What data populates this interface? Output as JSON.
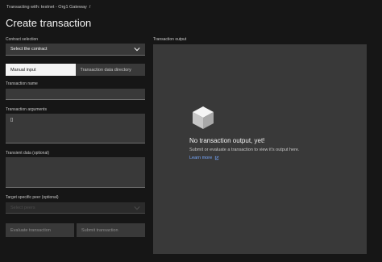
{
  "breadcrumb": {
    "text": "Transacting with: testnet - Org1 Gateway",
    "separator": "/"
  },
  "page_title": "Create transaction",
  "form": {
    "contract_selection": {
      "label": "Contract selection",
      "value": "Select the contract",
      "icon": "chevron-down-icon"
    },
    "tabs": [
      {
        "label": "Manual input",
        "selected": true
      },
      {
        "label": "Transaction data directory",
        "selected": false
      }
    ],
    "transaction_name": {
      "label": "Transaction name",
      "value": ""
    },
    "transaction_arguments": {
      "label": "Transaction arguments",
      "value": "[]"
    },
    "transient_data": {
      "label": "Transient data (optional)",
      "value": ""
    },
    "target_peer": {
      "label": "Target specific peer (optional)",
      "placeholder": "Select peers",
      "icon": "chevron-down-icon"
    },
    "buttons": {
      "evaluate": "Evaluate transaction",
      "submit": "Submit transaction"
    }
  },
  "output": {
    "label": "Transaction output",
    "empty_icon": "cube-icon",
    "empty_title": "No transaction output, yet!",
    "empty_description": "Submit or evaluate a transaction to view it's output here.",
    "learn_more": "Learn more",
    "learn_more_icon": "external-link-icon"
  },
  "colors": {
    "background": "#161616",
    "field": "#393939",
    "link": "#78a9ff",
    "text": "#f4f4f4"
  }
}
